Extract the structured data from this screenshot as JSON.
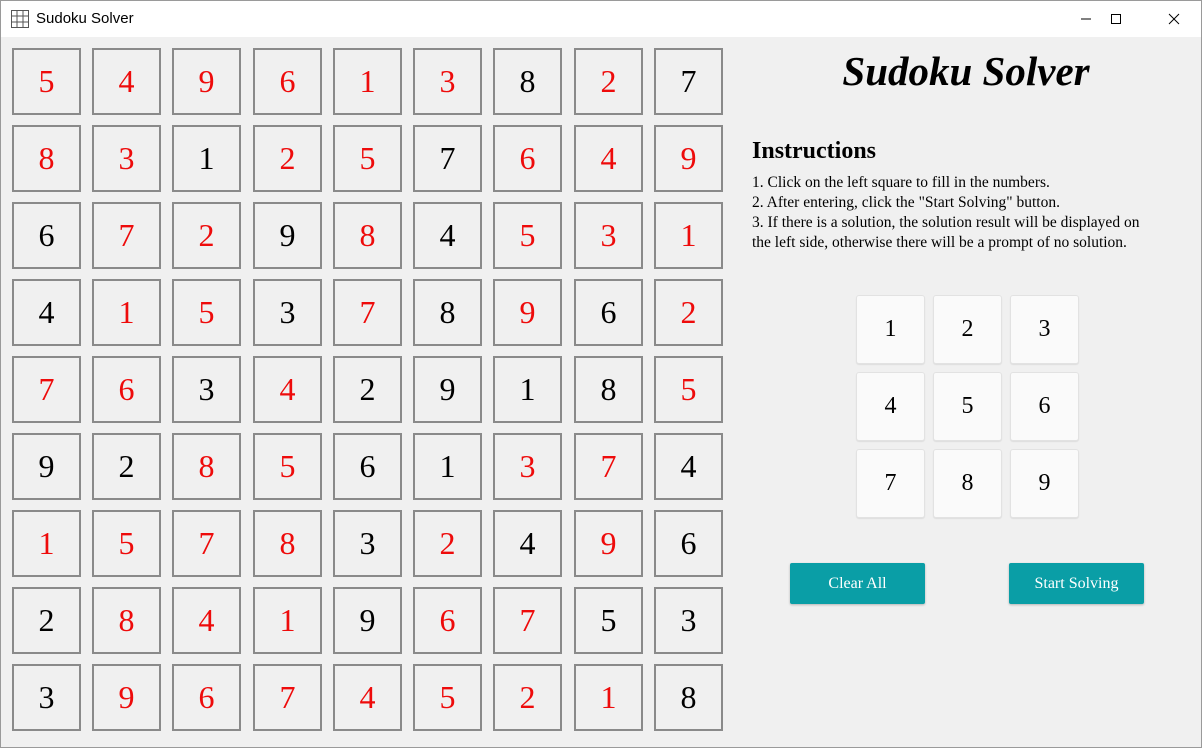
{
  "window": {
    "title": "Sudoku Solver"
  },
  "colors": {
    "filled": "#000000",
    "solved": "#ee0b0b",
    "accent": "#0a9ea6"
  },
  "board": {
    "values": [
      [
        5,
        4,
        9,
        6,
        1,
        3,
        8,
        2,
        7
      ],
      [
        8,
        3,
        1,
        2,
        5,
        7,
        6,
        4,
        9
      ],
      [
        6,
        7,
        2,
        9,
        8,
        4,
        5,
        3,
        1
      ],
      [
        4,
        1,
        5,
        3,
        7,
        8,
        9,
        6,
        2
      ],
      [
        7,
        6,
        3,
        4,
        2,
        9,
        1,
        8,
        5
      ],
      [
        9,
        2,
        8,
        5,
        6,
        1,
        3,
        7,
        4
      ],
      [
        1,
        5,
        7,
        8,
        3,
        2,
        4,
        9,
        6
      ],
      [
        2,
        8,
        4,
        1,
        9,
        6,
        7,
        5,
        3
      ],
      [
        3,
        9,
        6,
        7,
        4,
        5,
        2,
        1,
        8
      ]
    ],
    "solved_mask": [
      [
        1,
        1,
        1,
        1,
        1,
        1,
        0,
        1,
        0
      ],
      [
        1,
        1,
        0,
        1,
        1,
        0,
        1,
        1,
        1
      ],
      [
        0,
        1,
        1,
        0,
        1,
        0,
        1,
        1,
        1
      ],
      [
        0,
        1,
        1,
        0,
        1,
        0,
        1,
        0,
        1
      ],
      [
        1,
        1,
        0,
        1,
        0,
        0,
        0,
        0,
        1
      ],
      [
        0,
        0,
        1,
        1,
        0,
        0,
        1,
        1,
        0
      ],
      [
        1,
        1,
        1,
        1,
        0,
        1,
        0,
        1,
        0
      ],
      [
        0,
        1,
        1,
        1,
        0,
        1,
        1,
        0,
        0
      ],
      [
        0,
        1,
        1,
        1,
        1,
        1,
        1,
        1,
        0
      ]
    ]
  },
  "panel": {
    "heading": "Sudoku Solver",
    "instructions_title": "Instructions",
    "instructions": [
      "1. Click on the left square to fill in the numbers.",
      "2. After entering, click the \"Start Solving\" button.",
      "3. If there is a solution, the solution result will be displayed on",
      " the left side, otherwise there will be a prompt of no solution."
    ],
    "numpad": [
      "1",
      "2",
      "3",
      "4",
      "5",
      "6",
      "7",
      "8",
      "9"
    ],
    "clear_label": "Clear All",
    "solve_label": "Start Solving"
  }
}
